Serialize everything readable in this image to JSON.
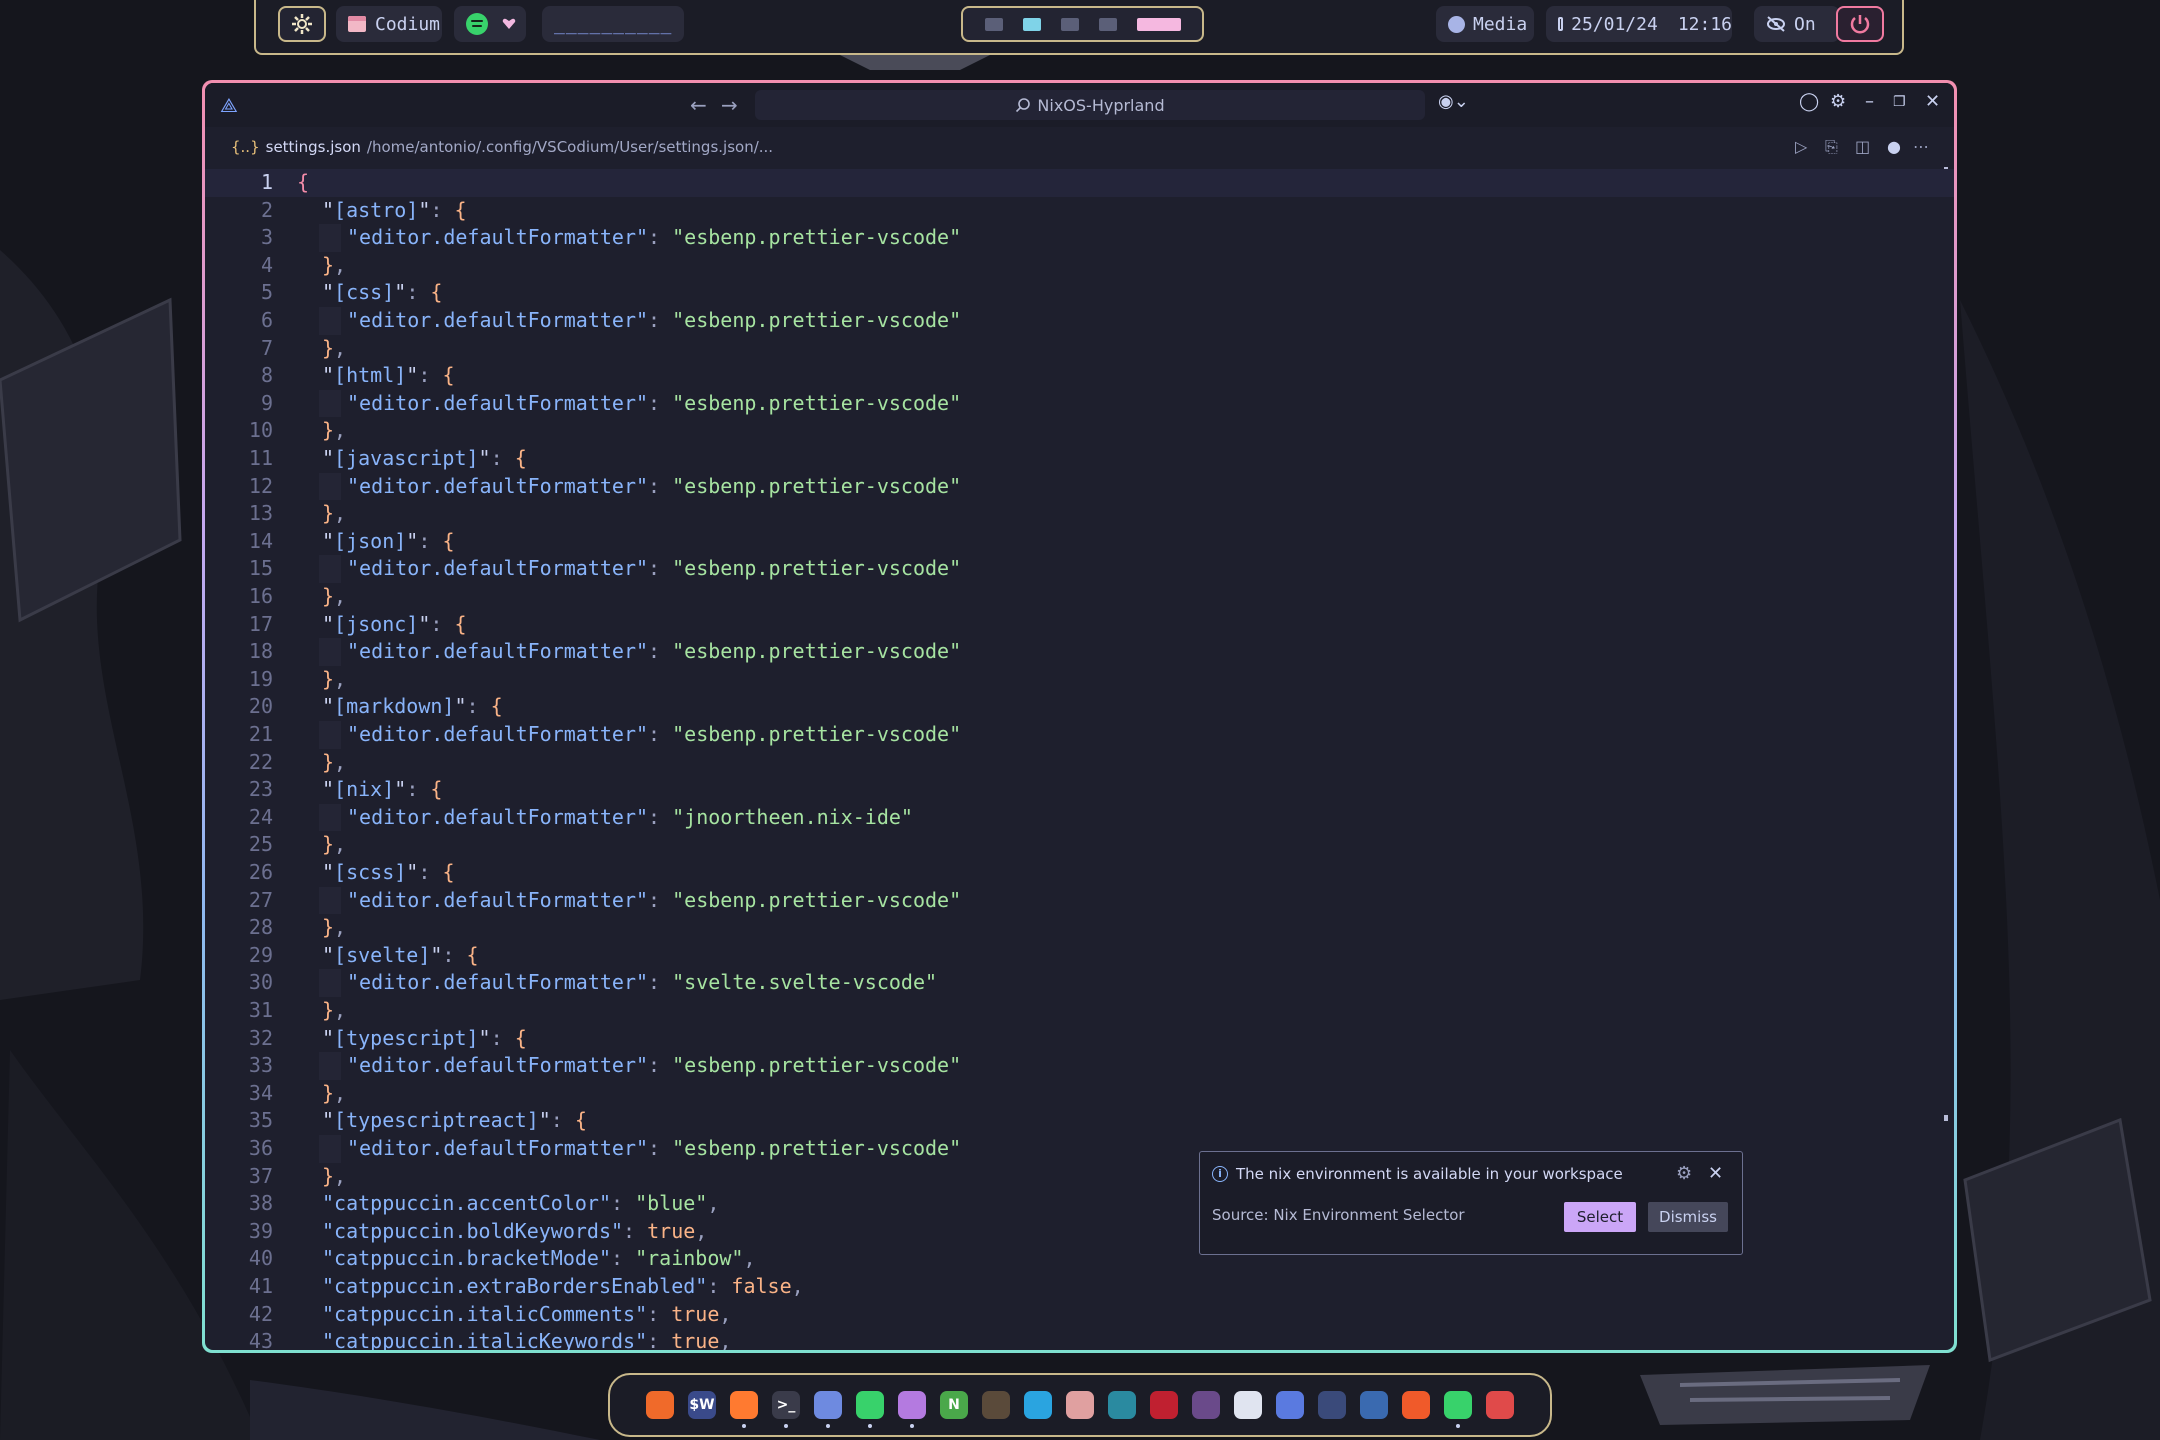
{
  "topbar": {
    "app_name": "Codium",
    "window_title": "__________",
    "media_label": "Media",
    "date": "25/01/24",
    "time": "12:16",
    "idle_label": "On",
    "workspaces": [
      {
        "state": "occupied"
      },
      {
        "state": "active"
      },
      {
        "state": "occupied"
      },
      {
        "state": "occupied"
      },
      {
        "state": "current"
      }
    ]
  },
  "window": {
    "search_text": "NixOS-Hyprland",
    "breadcrumb": {
      "brace_icon": "{..}",
      "file_name": "settings.json",
      "path": "/home/antonio/.config/VSCodium/User/settings.json/..."
    }
  },
  "editor": {
    "lines": [
      {
        "n": "1",
        "indent": 0,
        "tokens": [
          {
            "t": "{",
            "c": "br1"
          }
        ]
      },
      {
        "n": "2",
        "indent": 1,
        "tokens": [
          {
            "t": "\"",
            "c": "q"
          },
          {
            "t": "[astro]",
            "c": "k"
          },
          {
            "t": "\"",
            "c": "q"
          },
          {
            "t": ": ",
            "c": "p"
          },
          {
            "t": "{",
            "c": "br2"
          }
        ]
      },
      {
        "n": "3",
        "indent": 2,
        "tokens": [
          {
            "t": "\"editor.defaultFormatter\"",
            "c": "k"
          },
          {
            "t": ": ",
            "c": "p"
          },
          {
            "t": "\"esbenp.prettier-vscode\"",
            "c": "s"
          }
        ]
      },
      {
        "n": "4",
        "indent": 1,
        "tokens": [
          {
            "t": "}",
            "c": "br2"
          },
          {
            "t": ",",
            "c": "p"
          }
        ]
      },
      {
        "n": "5",
        "indent": 1,
        "tokens": [
          {
            "t": "\"",
            "c": "q"
          },
          {
            "t": "[css]",
            "c": "k"
          },
          {
            "t": "\"",
            "c": "q"
          },
          {
            "t": ": ",
            "c": "p"
          },
          {
            "t": "{",
            "c": "br2"
          }
        ]
      },
      {
        "n": "6",
        "indent": 2,
        "tokens": [
          {
            "t": "\"editor.defaultFormatter\"",
            "c": "k"
          },
          {
            "t": ": ",
            "c": "p"
          },
          {
            "t": "\"esbenp.prettier-vscode\"",
            "c": "s"
          }
        ]
      },
      {
        "n": "7",
        "indent": 1,
        "tokens": [
          {
            "t": "}",
            "c": "br2"
          },
          {
            "t": ",",
            "c": "p"
          }
        ]
      },
      {
        "n": "8",
        "indent": 1,
        "tokens": [
          {
            "t": "\"",
            "c": "q"
          },
          {
            "t": "[html]",
            "c": "k"
          },
          {
            "t": "\"",
            "c": "q"
          },
          {
            "t": ": ",
            "c": "p"
          },
          {
            "t": "{",
            "c": "br2"
          }
        ]
      },
      {
        "n": "9",
        "indent": 2,
        "tokens": [
          {
            "t": "\"editor.defaultFormatter\"",
            "c": "k"
          },
          {
            "t": ": ",
            "c": "p"
          },
          {
            "t": "\"esbenp.prettier-vscode\"",
            "c": "s"
          }
        ]
      },
      {
        "n": "10",
        "indent": 1,
        "tokens": [
          {
            "t": "}",
            "c": "br2"
          },
          {
            "t": ",",
            "c": "p"
          }
        ]
      },
      {
        "n": "11",
        "indent": 1,
        "tokens": [
          {
            "t": "\"",
            "c": "q"
          },
          {
            "t": "[javascript]",
            "c": "k"
          },
          {
            "t": "\"",
            "c": "q"
          },
          {
            "t": ": ",
            "c": "p"
          },
          {
            "t": "{",
            "c": "br2"
          }
        ]
      },
      {
        "n": "12",
        "indent": 2,
        "tokens": [
          {
            "t": "\"editor.defaultFormatter\"",
            "c": "k"
          },
          {
            "t": ": ",
            "c": "p"
          },
          {
            "t": "\"esbenp.prettier-vscode\"",
            "c": "s"
          }
        ]
      },
      {
        "n": "13",
        "indent": 1,
        "tokens": [
          {
            "t": "}",
            "c": "br2"
          },
          {
            "t": ",",
            "c": "p"
          }
        ]
      },
      {
        "n": "14",
        "indent": 1,
        "tokens": [
          {
            "t": "\"",
            "c": "q"
          },
          {
            "t": "[json]",
            "c": "k"
          },
          {
            "t": "\"",
            "c": "q"
          },
          {
            "t": ": ",
            "c": "p"
          },
          {
            "t": "{",
            "c": "br2"
          }
        ]
      },
      {
        "n": "15",
        "indent": 2,
        "tokens": [
          {
            "t": "\"editor.defaultFormatter\"",
            "c": "k"
          },
          {
            "t": ": ",
            "c": "p"
          },
          {
            "t": "\"esbenp.prettier-vscode\"",
            "c": "s"
          }
        ]
      },
      {
        "n": "16",
        "indent": 1,
        "tokens": [
          {
            "t": "}",
            "c": "br2"
          },
          {
            "t": ",",
            "c": "p"
          }
        ]
      },
      {
        "n": "17",
        "indent": 1,
        "tokens": [
          {
            "t": "\"",
            "c": "q"
          },
          {
            "t": "[jsonc]",
            "c": "k"
          },
          {
            "t": "\"",
            "c": "q"
          },
          {
            "t": ": ",
            "c": "p"
          },
          {
            "t": "{",
            "c": "br2"
          }
        ]
      },
      {
        "n": "18",
        "indent": 2,
        "tokens": [
          {
            "t": "\"editor.defaultFormatter\"",
            "c": "k"
          },
          {
            "t": ": ",
            "c": "p"
          },
          {
            "t": "\"esbenp.prettier-vscode\"",
            "c": "s"
          }
        ]
      },
      {
        "n": "19",
        "indent": 1,
        "tokens": [
          {
            "t": "}",
            "c": "br2"
          },
          {
            "t": ",",
            "c": "p"
          }
        ]
      },
      {
        "n": "20",
        "indent": 1,
        "tokens": [
          {
            "t": "\"",
            "c": "q"
          },
          {
            "t": "[markdown]",
            "c": "k"
          },
          {
            "t": "\"",
            "c": "q"
          },
          {
            "t": ": ",
            "c": "p"
          },
          {
            "t": "{",
            "c": "br2"
          }
        ]
      },
      {
        "n": "21",
        "indent": 2,
        "tokens": [
          {
            "t": "\"editor.defaultFormatter\"",
            "c": "k"
          },
          {
            "t": ": ",
            "c": "p"
          },
          {
            "t": "\"esbenp.prettier-vscode\"",
            "c": "s"
          }
        ]
      },
      {
        "n": "22",
        "indent": 1,
        "tokens": [
          {
            "t": "}",
            "c": "br2"
          },
          {
            "t": ",",
            "c": "p"
          }
        ]
      },
      {
        "n": "23",
        "indent": 1,
        "tokens": [
          {
            "t": "\"",
            "c": "q"
          },
          {
            "t": "[nix]",
            "c": "k"
          },
          {
            "t": "\"",
            "c": "q"
          },
          {
            "t": ": ",
            "c": "p"
          },
          {
            "t": "{",
            "c": "br2"
          }
        ]
      },
      {
        "n": "24",
        "indent": 2,
        "tokens": [
          {
            "t": "\"editor.defaultFormatter\"",
            "c": "k"
          },
          {
            "t": ": ",
            "c": "p"
          },
          {
            "t": "\"jnoortheen.nix-ide\"",
            "c": "s"
          }
        ]
      },
      {
        "n": "25",
        "indent": 1,
        "tokens": [
          {
            "t": "}",
            "c": "br2"
          },
          {
            "t": ",",
            "c": "p"
          }
        ]
      },
      {
        "n": "26",
        "indent": 1,
        "tokens": [
          {
            "t": "\"",
            "c": "q"
          },
          {
            "t": "[scss]",
            "c": "k"
          },
          {
            "t": "\"",
            "c": "q"
          },
          {
            "t": ": ",
            "c": "p"
          },
          {
            "t": "{",
            "c": "br2"
          }
        ]
      },
      {
        "n": "27",
        "indent": 2,
        "tokens": [
          {
            "t": "\"editor.defaultFormatter\"",
            "c": "k"
          },
          {
            "t": ": ",
            "c": "p"
          },
          {
            "t": "\"esbenp.prettier-vscode\"",
            "c": "s"
          }
        ]
      },
      {
        "n": "28",
        "indent": 1,
        "tokens": [
          {
            "t": "}",
            "c": "br2"
          },
          {
            "t": ",",
            "c": "p"
          }
        ]
      },
      {
        "n": "29",
        "indent": 1,
        "tokens": [
          {
            "t": "\"",
            "c": "q"
          },
          {
            "t": "[svelte]",
            "c": "k"
          },
          {
            "t": "\"",
            "c": "q"
          },
          {
            "t": ": ",
            "c": "p"
          },
          {
            "t": "{",
            "c": "br2"
          }
        ]
      },
      {
        "n": "30",
        "indent": 2,
        "tokens": [
          {
            "t": "\"editor.defaultFormatter\"",
            "c": "k"
          },
          {
            "t": ": ",
            "c": "p"
          },
          {
            "t": "\"svelte.svelte-vscode\"",
            "c": "s"
          }
        ]
      },
      {
        "n": "31",
        "indent": 1,
        "tokens": [
          {
            "t": "}",
            "c": "br2"
          },
          {
            "t": ",",
            "c": "p"
          }
        ]
      },
      {
        "n": "32",
        "indent": 1,
        "tokens": [
          {
            "t": "\"",
            "c": "q"
          },
          {
            "t": "[typescript]",
            "c": "k"
          },
          {
            "t": "\"",
            "c": "q"
          },
          {
            "t": ": ",
            "c": "p"
          },
          {
            "t": "{",
            "c": "br2"
          }
        ]
      },
      {
        "n": "33",
        "indent": 2,
        "tokens": [
          {
            "t": "\"editor.defaultFormatter\"",
            "c": "k"
          },
          {
            "t": ": ",
            "c": "p"
          },
          {
            "t": "\"esbenp.prettier-vscode\"",
            "c": "s"
          }
        ]
      },
      {
        "n": "34",
        "indent": 1,
        "tokens": [
          {
            "t": "}",
            "c": "br2"
          },
          {
            "t": ",",
            "c": "p"
          }
        ]
      },
      {
        "n": "35",
        "indent": 1,
        "tokens": [
          {
            "t": "\"",
            "c": "q"
          },
          {
            "t": "[typescriptreact]",
            "c": "k"
          },
          {
            "t": "\"",
            "c": "q"
          },
          {
            "t": ": ",
            "c": "p"
          },
          {
            "t": "{",
            "c": "br2"
          }
        ]
      },
      {
        "n": "36",
        "indent": 2,
        "tokens": [
          {
            "t": "\"editor.defaultFormatter\"",
            "c": "k"
          },
          {
            "t": ": ",
            "c": "p"
          },
          {
            "t": "\"esbenp.prettier-vscode\"",
            "c": "s"
          }
        ]
      },
      {
        "n": "37",
        "indent": 1,
        "tokens": [
          {
            "t": "}",
            "c": "br2"
          },
          {
            "t": ",",
            "c": "p"
          }
        ]
      },
      {
        "n": "38",
        "indent": 1,
        "tokens": [
          {
            "t": "\"catppuccin.accentColor\"",
            "c": "k"
          },
          {
            "t": ": ",
            "c": "p"
          },
          {
            "t": "\"blue\"",
            "c": "s"
          },
          {
            "t": ",",
            "c": "p"
          }
        ]
      },
      {
        "n": "39",
        "indent": 1,
        "tokens": [
          {
            "t": "\"catppuccin.boldKeywords\"",
            "c": "k"
          },
          {
            "t": ": ",
            "c": "p"
          },
          {
            "t": "true",
            "c": "bool"
          },
          {
            "t": ",",
            "c": "p"
          }
        ]
      },
      {
        "n": "40",
        "indent": 1,
        "tokens": [
          {
            "t": "\"catppuccin.bracketMode\"",
            "c": "k"
          },
          {
            "t": ": ",
            "c": "p"
          },
          {
            "t": "\"rainbow\"",
            "c": "s"
          },
          {
            "t": ",",
            "c": "p"
          }
        ]
      },
      {
        "n": "41",
        "indent": 1,
        "tokens": [
          {
            "t": "\"catppuccin.extraBordersEnabled\"",
            "c": "k"
          },
          {
            "t": ": ",
            "c": "p"
          },
          {
            "t": "false",
            "c": "bool"
          },
          {
            "t": ",",
            "c": "p"
          }
        ]
      },
      {
        "n": "42",
        "indent": 1,
        "tokens": [
          {
            "t": "\"catppuccin.italicComments\"",
            "c": "k"
          },
          {
            "t": ": ",
            "c": "p"
          },
          {
            "t": "true",
            "c": "bool"
          },
          {
            "t": ",",
            "c": "p"
          }
        ]
      },
      {
        "n": "43",
        "indent": 1,
        "tokens": [
          {
            "t": "\"catppuccin.italicKeywords\"",
            "c": "k"
          },
          {
            "t": ": ",
            "c": "p"
          },
          {
            "t": "true",
            "c": "bool"
          },
          {
            "t": ",",
            "c": "p"
          }
        ]
      }
    ],
    "current_line": "1"
  },
  "notification": {
    "message": "The nix environment is available in your workspace",
    "source": "Source: Nix Environment Selector",
    "select_label": "Select",
    "dismiss_label": "Dismiss"
  },
  "dock": {
    "apps": [
      {
        "name": "ubuntu-icon",
        "color": "#f06a2a",
        "glyph": "",
        "running": false
      },
      {
        "name": "steam-wallet-icon",
        "color": "#3a4a8a",
        "glyph": "$W",
        "running": false
      },
      {
        "name": "firefox-icon",
        "color": "#ff7a30",
        "glyph": "",
        "running": true
      },
      {
        "name": "terminal-icon",
        "color": "#3a3b4a",
        "glyph": ">_",
        "running": true
      },
      {
        "name": "vscodium-icon",
        "color": "#6e8ae0",
        "glyph": "",
        "running": true
      },
      {
        "name": "spotify-icon",
        "color": "#38d26b",
        "glyph": "",
        "running": true
      },
      {
        "name": "image-viewer-icon",
        "color": "#b47ae0",
        "glyph": "",
        "running": true
      },
      {
        "name": "neovim-icon",
        "color": "#4aa84a",
        "glyph": "N",
        "running": false
      },
      {
        "name": "mask-icon",
        "color": "#5a4a3a",
        "glyph": "",
        "running": false
      },
      {
        "name": "telegram-icon",
        "color": "#2aa4e0",
        "glyph": "",
        "running": false
      },
      {
        "name": "document-icon",
        "color": "#e0a0a0",
        "glyph": "",
        "running": false
      },
      {
        "name": "screen-share-icon",
        "color": "#2a8aa0",
        "glyph": "",
        "running": false
      },
      {
        "name": "red-app-icon",
        "color": "#c02030",
        "glyph": "",
        "running": false
      },
      {
        "name": "obs-icon",
        "color": "#6a4a8a",
        "glyph": "",
        "running": false
      },
      {
        "name": "stats-icon",
        "color": "#e0e4f0",
        "glyph": "",
        "running": false
      },
      {
        "name": "shield-app-icon",
        "color": "#5a7ae0",
        "glyph": "",
        "running": false
      },
      {
        "name": "usb-icon",
        "color": "#3a4a7a",
        "glyph": "",
        "running": false
      },
      {
        "name": "hyprland-icon",
        "color": "#3a6ab0",
        "glyph": "",
        "running": false
      },
      {
        "name": "close-app-icon",
        "color": "#f05a2a",
        "glyph": "",
        "running": false
      },
      {
        "name": "spotify-second-icon",
        "color": "#38d26b",
        "glyph": "",
        "running": true
      },
      {
        "name": "pdf-icon",
        "color": "#e04a4a",
        "glyph": "",
        "running": false
      }
    ]
  }
}
